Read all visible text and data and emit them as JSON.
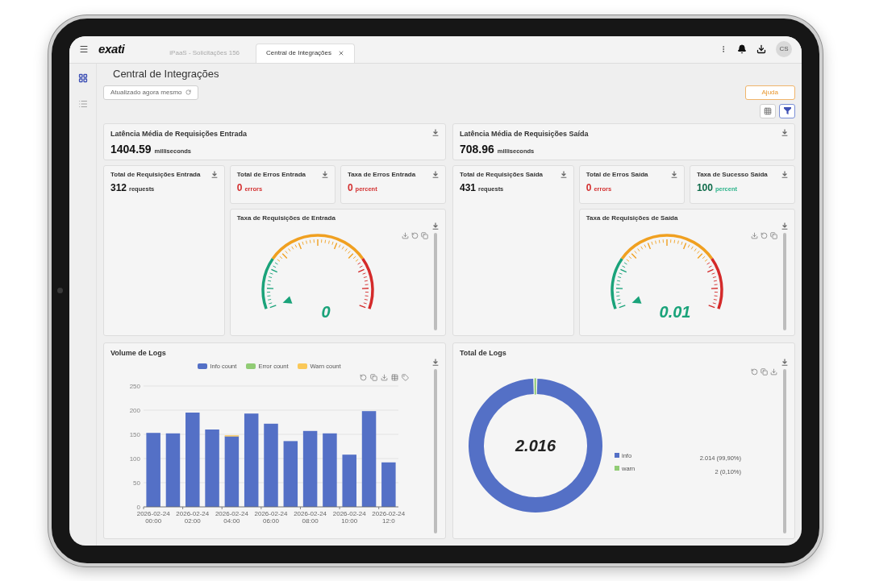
{
  "header": {
    "logo": "exati",
    "tabs": [
      {
        "label": "iPaaS - Solicitações 156",
        "selected": false,
        "closable": false
      },
      {
        "label": "Central de Integrações",
        "selected": true,
        "closable": true
      }
    ],
    "avatar": "CS"
  },
  "sidebar": {
    "items": [
      {
        "kind": "dashboard",
        "selected": true
      },
      {
        "kind": "list",
        "selected": false
      }
    ]
  },
  "page": {
    "title": "Central de Integrações",
    "refresh_button": "Atualizado agora mesmo",
    "help_button": "Ajuda"
  },
  "sections": [
    {
      "latency": {
        "title": "Latência Média de Requisições Entrada",
        "value": "1404.59",
        "unit": "milliseconds"
      },
      "total": {
        "title": "Total de Requisições Entrada",
        "value": "312",
        "unit": "requests",
        "kind": "plain"
      },
      "metrics": [
        {
          "title": "Total de Erros Entrada",
          "value": "0",
          "unit": "errors",
          "kind": "error"
        },
        {
          "title": "Taxa de Erros Entrada",
          "value": "0",
          "unit": "percent",
          "kind": "error"
        }
      ],
      "gauge": {
        "title": "Taxa de Requisições de Entrada",
        "value": "0"
      }
    },
    {
      "latency": {
        "title": "Latência Média de Requisições Saída",
        "value": "708.96",
        "unit": "milliseconds"
      },
      "total": {
        "title": "Total de Requisições Saída",
        "value": "431",
        "unit": "requests",
        "kind": "plain"
      },
      "metrics": [
        {
          "title": "Total de Erros Saída",
          "value": "0",
          "unit": "errors",
          "kind": "error"
        },
        {
          "title": "Taxa de Sucesso Saída",
          "value": "100",
          "unit": "percent",
          "kind": "success"
        }
      ],
      "gauge": {
        "title": "Taxa de Requisições de Saída",
        "value": "0.01"
      }
    }
  ],
  "logs": [
    {
      "title": "Volume de Logs",
      "chart_data": {
        "type": "bar",
        "stacked": true,
        "grid": true,
        "categories": [
          "2026-02-24 00:00",
          null,
          "2026-02-24 02:00",
          null,
          "2026-02-24 04:00",
          null,
          "2026-02-24 06:00",
          null,
          "2026-02-24 08:00",
          null,
          "2026-02-24 10:00",
          null,
          "2026-02-24 12:0"
        ],
        "ylim": [
          0,
          250
        ],
        "yticks": [
          0,
          50,
          100,
          150,
          200,
          250
        ],
        "series": [
          {
            "name": "Info count",
            "color": "#5470c6",
            "values": [
              153,
              152,
              195,
              160,
              146,
              193,
              172,
              136,
              157,
              152,
              108,
              198,
              92
            ]
          },
          {
            "name": "Error count",
            "color": "#91cc75",
            "values": [
              0,
              0,
              0,
              0,
              0,
              0,
              0,
              0,
              0,
              0,
              0,
              0,
              0
            ]
          },
          {
            "name": "Warn count",
            "color": "#fac858",
            "values": [
              0,
              0,
              0,
              0,
              2,
              0,
              0,
              0,
              0,
              0,
              0,
              0,
              0
            ]
          }
        ]
      }
    },
    {
      "title": "Total de Logs",
      "total": "2.016",
      "labels": [
        "2.014 (99,90%)",
        "2 (0,10%)"
      ],
      "chart_data": {
        "type": "donut",
        "categories": [
          "info",
          "warn"
        ],
        "values": [
          99.9,
          0.1
        ],
        "colors": [
          "#5470c6",
          "#91cc75"
        ]
      }
    }
  ]
}
